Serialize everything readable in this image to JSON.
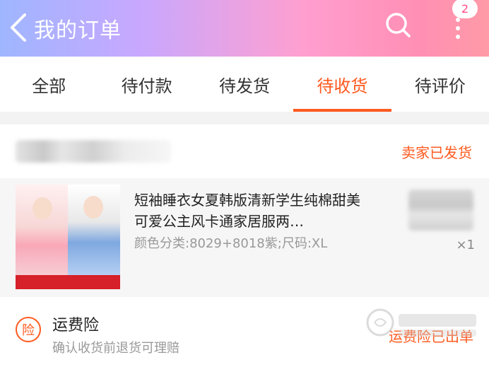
{
  "header": {
    "title": "我的订单",
    "badge_count": "2",
    "back_icon": "chevron-left-icon",
    "search_icon": "search-icon",
    "more_icon": "more-vertical-icon",
    "gradient_colors": [
      "#9fb6ff",
      "#c7a8ff",
      "#ff9fd0",
      "#ff8fb5"
    ]
  },
  "tabs": [
    {
      "label": "全部",
      "active": false
    },
    {
      "label": "待付款",
      "active": false
    },
    {
      "label": "待发货",
      "active": false
    },
    {
      "label": "待收货",
      "active": true
    },
    {
      "label": "待评价",
      "active": false
    }
  ],
  "order": {
    "status": "卖家已发货",
    "item": {
      "title": "短袖睡衣女夏韩版清新学生纯棉甜美可爱公主风卡通家居服两…",
      "spec": "颜色分类:8029+8018紫;尺码:XL",
      "quantity": "×1"
    },
    "insurance": {
      "icon_label": "险",
      "title": "运费险",
      "desc": "确认收货前退货可理赔",
      "status": "运费险已出单"
    }
  },
  "colors": {
    "accent": "#ff5a1f",
    "text": "#222222",
    "muted": "#999999"
  }
}
